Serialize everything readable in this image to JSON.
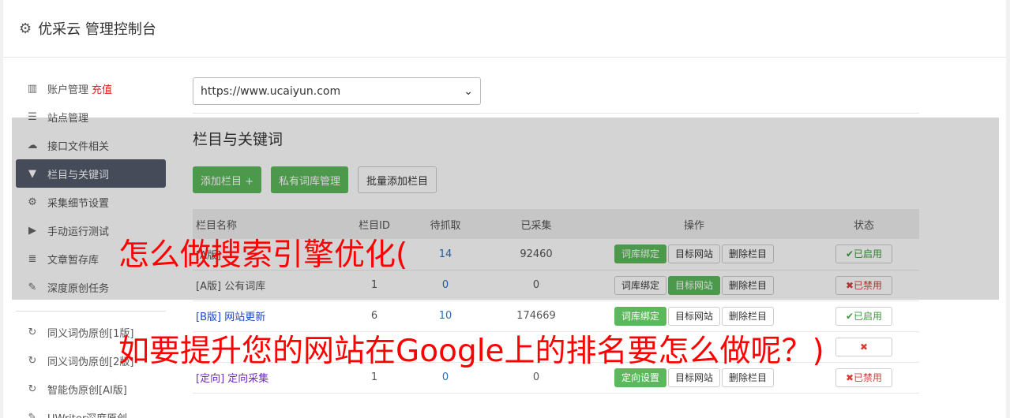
{
  "header": {
    "title": "优采云 管理控制台",
    "icon": "gear-icon"
  },
  "sidebar": {
    "items": [
      {
        "label": "账户管理",
        "badge": "充值",
        "icon": "bar-chart-icon"
      },
      {
        "label": "站点管理",
        "icon": "server-icon"
      },
      {
        "label": "接口文件相关",
        "icon": "cloud-upload-icon"
      },
      {
        "label": "栏目与关键词",
        "icon": "filter-icon",
        "active": true
      },
      {
        "label": "采集细节设置",
        "icon": "cogs-icon"
      },
      {
        "label": "手动运行测试",
        "icon": "play-icon"
      },
      {
        "label": "文章暂存库",
        "icon": "database-icon"
      },
      {
        "label": "深度原创任务",
        "icon": "edit-icon"
      }
    ],
    "items2": [
      {
        "label": "同义词伪原创[1版]",
        "icon": "refresh-icon"
      },
      {
        "label": "同义词伪原创[2版]",
        "icon": "refresh-icon"
      },
      {
        "label": "智能伪原创[AI版]",
        "icon": "refresh-icon"
      },
      {
        "label": "UWriter深度原创",
        "icon": "edit-icon"
      }
    ]
  },
  "main": {
    "site_select": "https://www.ucaiyun.com",
    "section_title": "栏目与关键词",
    "buttons": {
      "add": "添加栏目 +",
      "private": "私有词库管理",
      "batch": "批量添加栏目"
    },
    "table": {
      "headers": [
        "栏目名称",
        "栏目ID",
        "待抓取",
        "已采集",
        "操作",
        "状态"
      ],
      "rows": [
        {
          "name_tag": "[A版]",
          "name": "",
          "id": "",
          "pending": "14",
          "collected": "92460",
          "ops": [
            "词库绑定",
            "目标网站",
            "删除栏目"
          ],
          "status": "已启用"
        },
        {
          "name_tag": "[A版]",
          "name": "公有词库",
          "id": "1",
          "pending": "0",
          "collected": "0",
          "ops": [
            "词库绑定",
            "目标网站",
            "删除栏目"
          ],
          "status": "已禁用"
        },
        {
          "name_tag": "[B版]",
          "name": "网站更新",
          "id": "6",
          "pending": "10",
          "collected": "174669",
          "ops": [
            "词库绑定",
            "目标网站",
            "删除栏目"
          ],
          "status": "已启用"
        },
        {
          "name_tag": "",
          "name": "",
          "id": "",
          "pending": "",
          "collected": "",
          "ops": [
            "",
            "",
            ""
          ],
          "status": ""
        },
        {
          "name_tag": "[定向]",
          "name": "定向采集",
          "id": "1",
          "pending": "0",
          "collected": "0",
          "ops": [
            "定向设置",
            "目标网站",
            "删除栏目"
          ],
          "status": "已禁用"
        }
      ]
    }
  },
  "watermark": {
    "line1": "怎么做搜索引擎优化(",
    "line2": "如要提升您的网站在Google上的排名要怎么做呢？)"
  }
}
